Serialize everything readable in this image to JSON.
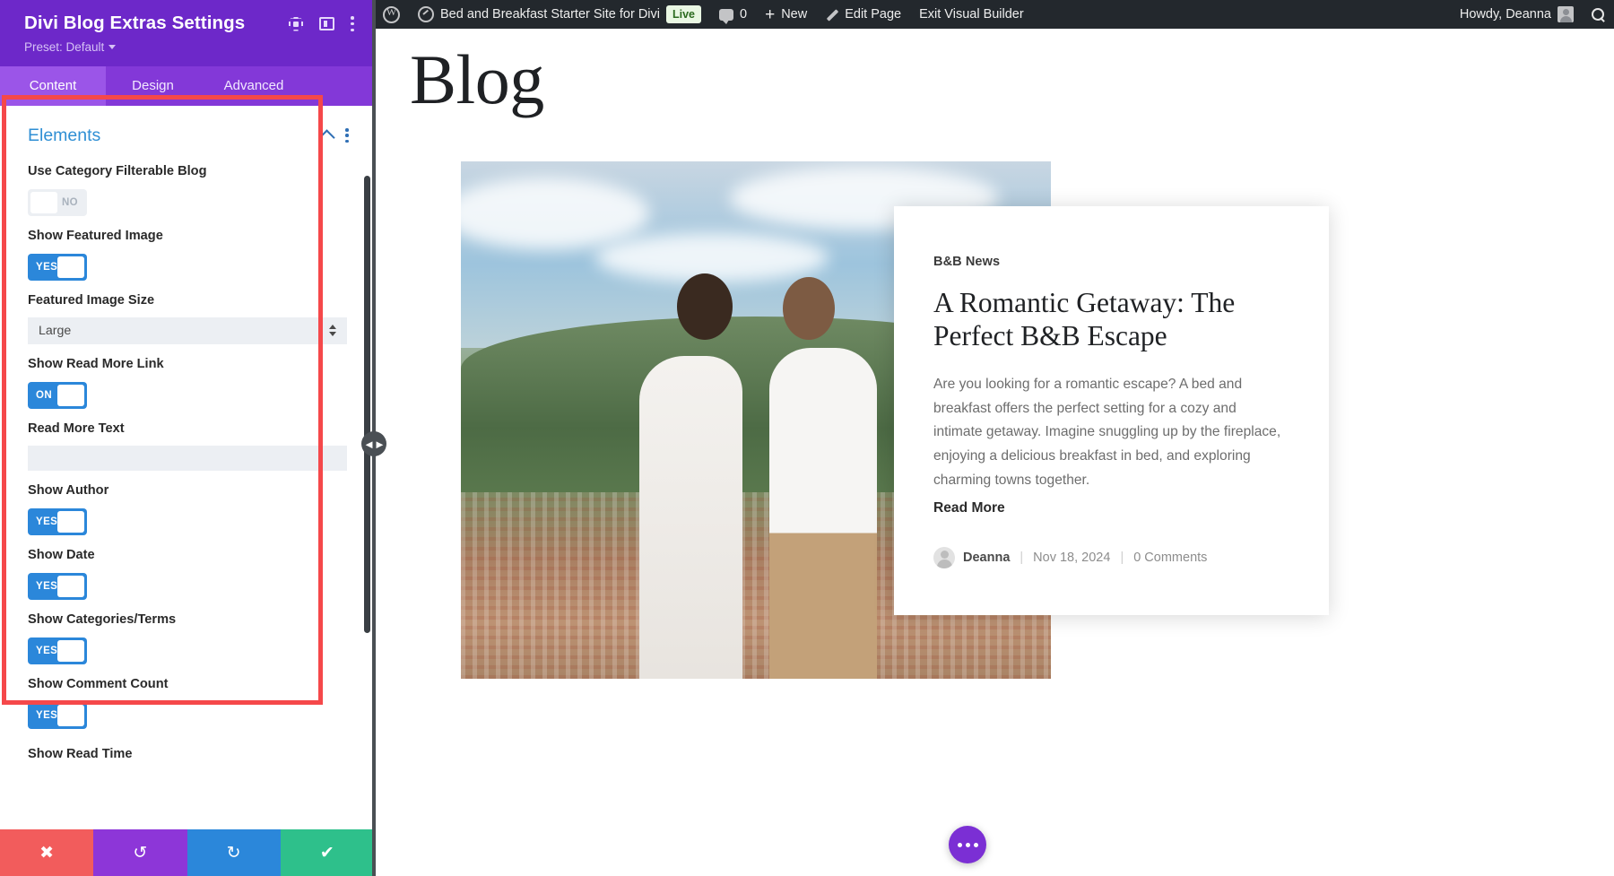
{
  "admin_bar": {
    "wp_logo": "wordpress-logo-icon",
    "site_name": "Bed and Breakfast Starter Site for Divi",
    "live_badge": "Live",
    "comment_count": "0",
    "new_label": "New",
    "edit_page_label": "Edit Page",
    "exit_builder_label": "Exit Visual Builder",
    "howdy": "Howdy, Deanna"
  },
  "site": {
    "page_heading": "Blog",
    "post": {
      "category": "B&B News",
      "title": "A Romantic Getaway: The Perfect B&B Escape",
      "excerpt": "Are you looking for a romantic escape? A bed and breakfast offers the perfect setting for a cozy and intimate getaway. Imagine snuggling up by the fireplace, enjoying a delicious breakfast in bed, and exploring charming towns together.",
      "read_more": "Read More",
      "author": "Deanna",
      "date": "Nov 18, 2024",
      "comments": "0 Comments",
      "separator": "|"
    }
  },
  "panel": {
    "title": "Divi Blog Extras Settings",
    "preset_label": "Preset: Default",
    "tabs": [
      {
        "label": "Content",
        "active": true
      },
      {
        "label": "Design",
        "active": false
      },
      {
        "label": "Advanced",
        "active": false
      }
    ],
    "section": {
      "title": "Elements"
    },
    "fields": [
      {
        "label": "Use Category Filterable Blog",
        "type": "toggle",
        "value": "NO",
        "state": "off"
      },
      {
        "label": "Show Featured Image",
        "type": "toggle",
        "value": "YES",
        "state": "on"
      },
      {
        "label": "Featured Image Size",
        "type": "select",
        "value": "Large"
      },
      {
        "label": "Show Read More Link",
        "type": "toggle",
        "value": "ON",
        "state": "on"
      },
      {
        "label": "Read More Text",
        "type": "text",
        "value": "",
        "placeholder": ""
      },
      {
        "label": "Show Author",
        "type": "toggle",
        "value": "YES",
        "state": "on"
      },
      {
        "label": "Show Date",
        "type": "toggle",
        "value": "YES",
        "state": "on"
      },
      {
        "label": "Show Categories/Terms",
        "type": "toggle",
        "value": "YES",
        "state": "on"
      },
      {
        "label": "Show Comment Count",
        "type": "toggle",
        "value": "YES",
        "state": "on"
      },
      {
        "label": "Show Read Time",
        "type": "label-only"
      }
    ],
    "footer": {
      "cancel": "✖",
      "undo": "↺",
      "redo": "↻",
      "save": "✔"
    }
  },
  "colors": {
    "panel_header": "#6d28c9",
    "tab_bar": "#8338d8",
    "tab_active": "#9b55e8",
    "toggle_on": "#2b87da",
    "section_title": "#2f8fd4",
    "highlight_box": "#f5484a",
    "fab": "#7B2FD4",
    "admin_bar": "#23282d"
  }
}
